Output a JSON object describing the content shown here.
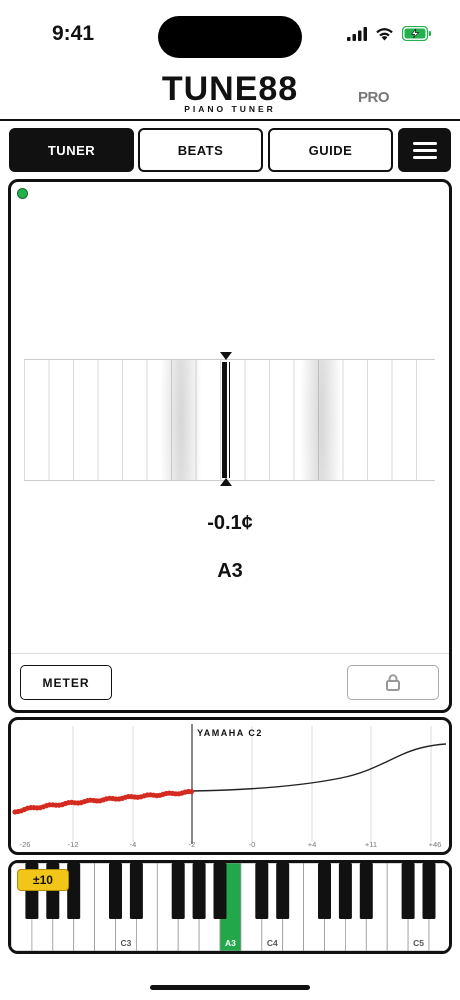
{
  "status": {
    "time": "9:41"
  },
  "header": {
    "logo_main": "TUNE88",
    "logo_sub": "PIANO TUNER",
    "pro": "PRO"
  },
  "tabs": [
    {
      "label": "TUNER",
      "active": true
    },
    {
      "label": "BEATS",
      "active": false
    },
    {
      "label": "GUIDE",
      "active": false
    }
  ],
  "tuner": {
    "cents": "-0.1¢",
    "note": "A3",
    "meter_label": "METER",
    "signal_color": "#22b14c"
  },
  "curve": {
    "title": "YAMAHA C2",
    "tick_labels": [
      "-26",
      "-12",
      "-4",
      "-2",
      "-0",
      "+4",
      "+11",
      "+46"
    ],
    "measured_color": "#d42a20"
  },
  "keyboard": {
    "range_badge": "±10",
    "labels": {
      "c3": "C3",
      "a3": "A3",
      "c4": "C4",
      "c5": "C5"
    },
    "selected_note": "A3",
    "selected_color": "#22a74a",
    "badge_color": "#f2c618"
  },
  "icons": {
    "menu": "hamburger-icon",
    "lock": "lock-icon",
    "signal": "signal-icon",
    "wifi": "wifi-icon",
    "battery": "battery-charging-icon"
  }
}
